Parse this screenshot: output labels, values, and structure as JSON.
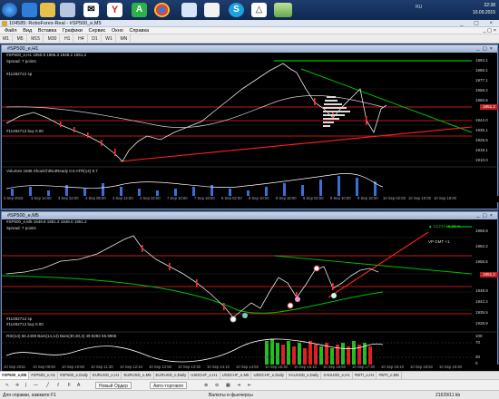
{
  "taskbar": {
    "icons": [
      "start-orb",
      "ie-icon",
      "folder-icon",
      "yandex-icon",
      "android-icon",
      "chrome-icon",
      "explorer-icon",
      "skype-icon",
      "alert-icon",
      "media-icon",
      "metatrader-icon"
    ],
    "lang": "RU",
    "clock_time": "22:38",
    "clock_date": "10.09.2015"
  },
  "window": {
    "title": "104585: RoboForex-Real - #SP500_e,M5",
    "controls": "_ ▢ ×"
  },
  "menu": {
    "items": [
      "Файл",
      "Вид",
      "Вставка",
      "Графики",
      "Сервис",
      "Окно",
      "Справка"
    ],
    "right": "_ ▢ ×"
  },
  "timeframes": [
    "M1",
    "M5",
    "M15",
    "M30",
    "H1",
    "H4",
    "D1",
    "W1",
    "MN"
  ],
  "chart_top": {
    "title": "#SP500_e,H1",
    "ohlc": "#SP500_e,H1 1950.8 1955.3 1949.2 1951.2",
    "spread": "Spread: 7 points",
    "label_id": "#11492712 sp",
    "label_buy": "#11492712 buy 0.00",
    "indicator": "Volumes 1938 ShowChtNotReady 0.0 ATR(14) 8.7",
    "price_current": "1951.2",
    "y_labels": [
      "1994.1",
      "1986.1",
      "1977.1",
      "1969.2",
      "1960.6",
      "1952.8",
      "1944.0",
      "1935.1",
      "1926.5",
      "1918.1",
      "1910.0"
    ],
    "x_labels": [
      "3 Sep 2015",
      "3 Sep 14:00",
      "3 Sep 22:00",
      "4 Sep 06:00",
      "4 Sep 14:00",
      "4 Sep 22:00",
      "7 Sep 10:00",
      "7 Sep 18:00",
      "8 Sep 02:00",
      "8 Sep 10:00",
      "8 Sep 18:00",
      "9 Sep 02:00",
      "9 Sep 10:00",
      "9 Sep 18:00",
      "10 Sep 02:00",
      "10 Sep 10:00",
      "10 Sep 18:00"
    ]
  },
  "chart_bottom": {
    "title": "#SP500_e,M5",
    "ohlc": "#SP500_e,M5 1949.8 1951.2 1948.0 1951.2",
    "spread": "Spread: 7 points",
    "top_right": "▲ CLCH / 0.33 %",
    "label_vp": "VP GMT +1",
    "label_id": "#11492712 sp",
    "label_buy": "#11492712 buy 0.00",
    "indicator": "RSI(14) 56.2409  Bars(14,14)  Bars(30,30,3) 49.9292 55.9905",
    "price_current": "1951.2",
    "y_labels": [
      "1968.8",
      "1962.2",
      "1955.5",
      "1951.2",
      "1948.9",
      "1942.2",
      "1935.5",
      "1928.9",
      "100",
      "70",
      "30",
      "0"
    ],
    "x_labels": [
      "10 Sep 2015",
      "10 Sep 09:50",
      "10 Sep 10:50",
      "10 Sep 11:30",
      "10 Sep 12:10",
      "10 Sep 12:50",
      "10 Sep 13:30",
      "10 Sep 14:10",
      "10 Sep 14:50",
      "10 Sep 15:30",
      "10 Sep 16:10",
      "10 Sep 16:50",
      "10 Sep 17:30",
      "10 Sep 18:10",
      "10 Sep 18:50",
      "10 Sep 19:30"
    ]
  },
  "tabs": [
    "#SP500_e,M5",
    "#SP500_e,H1",
    "#SP500_e,Daily",
    "EURUSD_e,H1",
    "EURUSD_e,M5",
    "EURUSD_e,Daily",
    "USDCHF_e,H1",
    "USDCHF_e,M5",
    "USDCHF_e,Daily",
    "XAUUSD_e,Daily",
    "XAUUSD_e,H1",
    "#WTI_e,H1",
    "#WTI_e,M5"
  ],
  "bottom_toolbar": {
    "new_order": "Новый Ордер",
    "autotrade": "Авто-торговля"
  },
  "status": {
    "help": "Для справки, нажмите F1",
    "profile": "Валюты и фьючерсы",
    "memory": "21629/11 kb"
  },
  "colors": {
    "red_level": "#ff2020",
    "green_trend": "#00c000",
    "chart_bg": "#000000",
    "candle_up": "#ffffff",
    "candle_down": "#ff3030"
  }
}
